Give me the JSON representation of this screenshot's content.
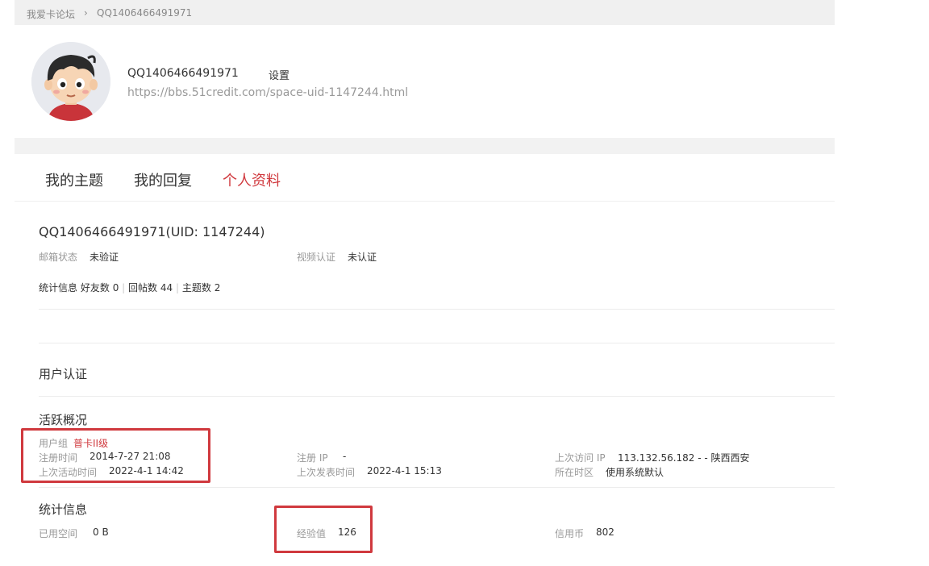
{
  "breadcrumb": {
    "home": "我爱卡论坛",
    "separator": "›",
    "current": "QQ1406466491971"
  },
  "profile": {
    "username": "QQ1406466491971",
    "settings_label": "设置",
    "space_url": "https://bbs.51credit.com/space-uid-1147244.html"
  },
  "tabs": [
    {
      "label": "我的主题"
    },
    {
      "label": "我的回复"
    },
    {
      "label": "个人资料",
      "active": true
    }
  ],
  "info": {
    "title": "QQ1406466491971(UID: 1147244)",
    "email_label": "邮箱状态",
    "email_value": "未验证",
    "video_label": "视频认证",
    "video_value": "未认证",
    "stats_prefix": "统计信息",
    "friends_label": "好友数",
    "friends_value": "0",
    "replies_label": "回帖数",
    "replies_value": "44",
    "topics_label": "主题数",
    "topics_value": "2",
    "divider": "|"
  },
  "user_cert": {
    "title": "用户认证"
  },
  "activity": {
    "title": "活跃概况",
    "group_label": "用户组",
    "group_value": "普卡II级",
    "register_time_label": "注册时间",
    "register_time_value": "2014-7-27 21:08",
    "last_active_label": "上次活动时间",
    "last_active_value": "2022-4-1 14:42",
    "register_ip_label": "注册 IP",
    "register_ip_value": "-",
    "last_post_label": "上次发表时间",
    "last_post_value": "2022-4-1 15:13",
    "last_ip_label": "上次访问 IP",
    "last_ip_value": "113.132.56.182 - - 陕西西安",
    "timezone_label": "所在时区",
    "timezone_value": "使用系统默认"
  },
  "stats": {
    "title": "统计信息",
    "space_label": "已用空间",
    "space_value": "0 B",
    "exp_label": "经验值",
    "exp_value": "126",
    "credit_label": "信用币",
    "credit_value": "802"
  },
  "colors": {
    "accent": "#d0393e",
    "page_bg": "#f2f2f2",
    "muted": "#999999"
  }
}
